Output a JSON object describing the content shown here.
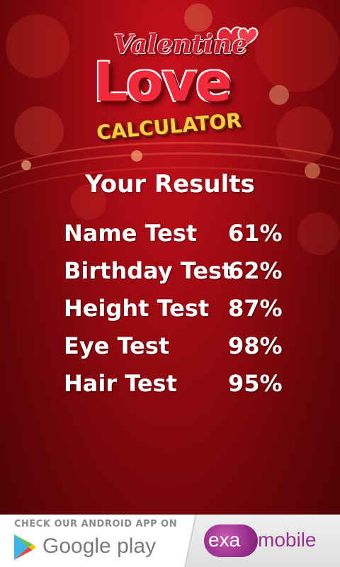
{
  "logo": {
    "line1": "Valentine",
    "line2": "Love",
    "line3": "CALCULATOR"
  },
  "results_title": "Your Results",
  "results": [
    {
      "label": "Name Test",
      "value": "61%"
    },
    {
      "label": "Birthday Test",
      "value": "62%"
    },
    {
      "label": "Height Test",
      "value": "87%"
    },
    {
      "label": "Eye Test",
      "value": "98%"
    },
    {
      "label": "Hair Test",
      "value": "95%"
    }
  ],
  "ad": {
    "check_text": "CHECK OUR ANDROID APP ON",
    "store_text": "Google play",
    "brand_prefix": "exa",
    "brand_suffix": "mobile"
  },
  "colors": {
    "background": "#9d0a12",
    "text": "#ffffff",
    "brand": "#9a2f8e"
  }
}
